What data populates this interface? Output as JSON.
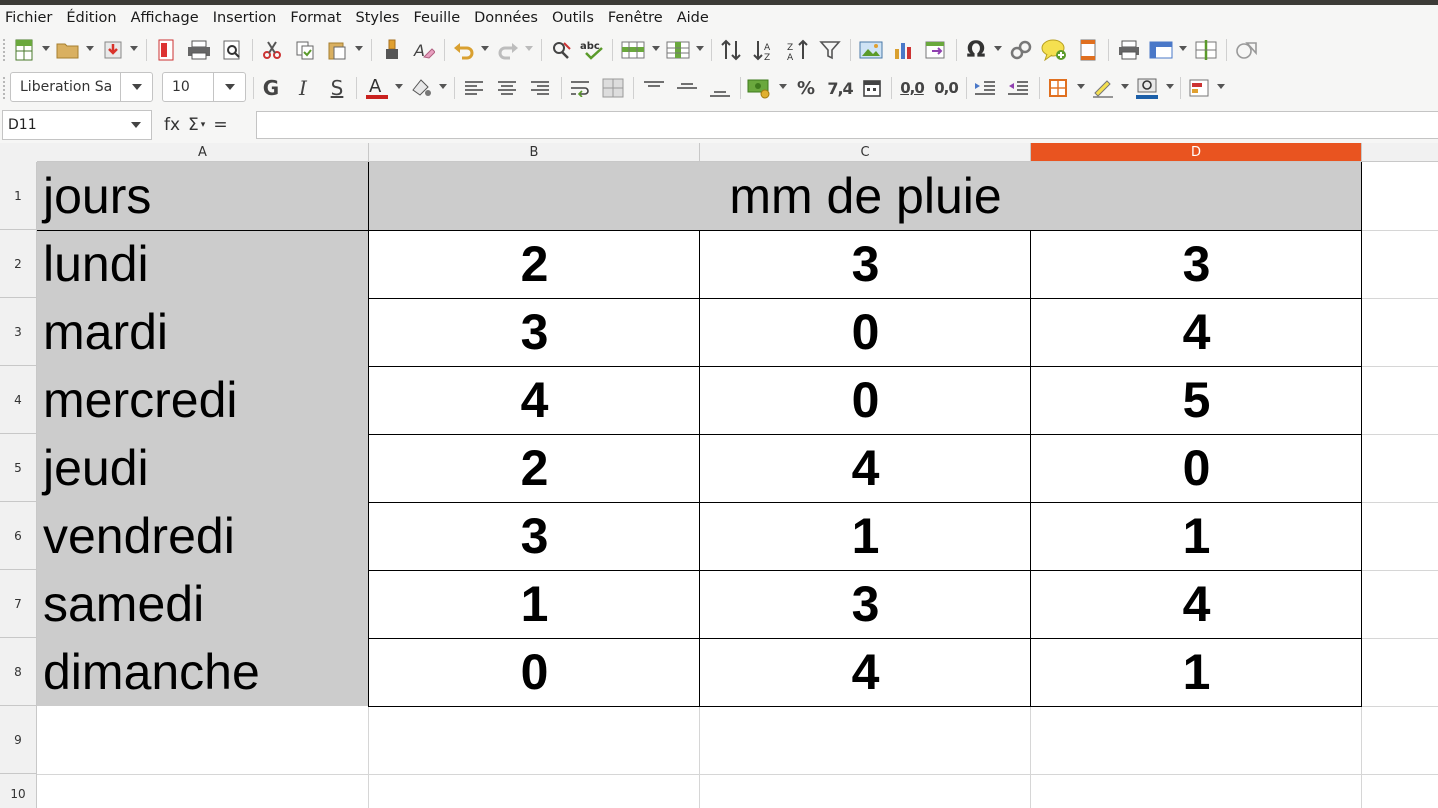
{
  "menu": [
    "Fichier",
    "Édition",
    "Affichage",
    "Insertion",
    "Format",
    "Styles",
    "Feuille",
    "Données",
    "Outils",
    "Fenêtre",
    "Aide"
  ],
  "font_name": "Liberation Sa",
  "font_size": "10",
  "name_box": "D11",
  "formula_icons": {
    "fx": "fx",
    "sigma": "Σ",
    "equals": "="
  },
  "formula_value": "",
  "format_icons": {
    "bold": "G",
    "italic": "I",
    "shadow": "S",
    "percent": "%",
    "number": "7,4",
    "add_decimal": "0,0",
    "del_decimal": "0,0"
  },
  "columns": [
    "A",
    "B",
    "C",
    "D"
  ],
  "active_column": "D",
  "rows": [
    "1",
    "2",
    "3",
    "4",
    "5",
    "6",
    "7",
    "8",
    "9",
    "10"
  ],
  "sheet": {
    "header_days": "jours",
    "header_rain": "mm de pluie",
    "data": [
      {
        "day": "lundi",
        "b": "2",
        "c": "3",
        "d": "3"
      },
      {
        "day": "mardi",
        "b": "3",
        "c": "0",
        "d": "4"
      },
      {
        "day": "mercredi",
        "b": "4",
        "c": "0",
        "d": "5"
      },
      {
        "day": "jeudi",
        "b": "2",
        "c": "4",
        "d": "0"
      },
      {
        "day": "vendredi",
        "b": "3",
        "c": "1",
        "d": "1"
      },
      {
        "day": "samedi",
        "b": "1",
        "c": "3",
        "d": "4"
      },
      {
        "day": "dimanche",
        "b": "0",
        "c": "4",
        "d": "1"
      }
    ]
  },
  "colors": {
    "active_header": "#e95420",
    "grey_fill": "#cccccc",
    "toolbar_bg": "#f6f6f5"
  }
}
